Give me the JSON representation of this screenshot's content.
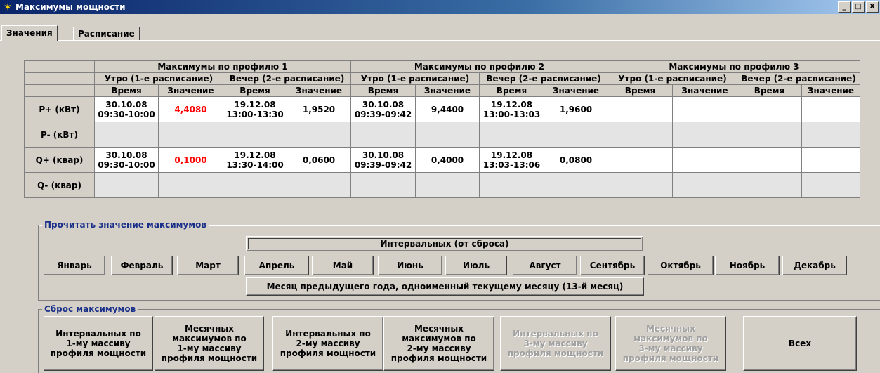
{
  "window": {
    "title": "Максимумы мощности",
    "controls": [
      "_",
      "□",
      "X"
    ]
  },
  "tabs": [
    {
      "label": "Значения",
      "active": true
    },
    {
      "label": "Расписание",
      "active": false
    }
  ],
  "table": {
    "profiles": [
      "Максимумы по профилю 1",
      "Максимумы по профилю 2",
      "Максимумы по профилю 3"
    ],
    "schedules": [
      "Утро (1-е расписание)",
      "Вечер (2-е расписание)"
    ],
    "col_time": "Время",
    "col_value": "Значение",
    "rows": [
      {
        "label": "P+ (кВт)",
        "cells": [
          {
            "t1": "30.10.08",
            "t2": "09:30-10:00"
          },
          {
            "v": "4,4080",
            "red": true
          },
          {
            "t1": "19.12.08",
            "t2": "13:00-13:30"
          },
          {
            "v": "1,9520"
          },
          {
            "t1": "30.10.08",
            "t2": "09:39-09:42"
          },
          {
            "v": "9,4400"
          },
          {
            "t1": "19.12.08",
            "t2": "13:00-13:03"
          },
          {
            "v": "1,9600"
          },
          {},
          {},
          {},
          {}
        ]
      },
      {
        "label": "P- (кВт)",
        "cells": [
          {},
          {},
          {},
          {},
          {},
          {},
          {},
          {},
          {},
          {},
          {},
          {}
        ]
      },
      {
        "label": "Q+ (квар)",
        "cells": [
          {
            "t1": "30.10.08",
            "t2": "09:30-10:00"
          },
          {
            "v": "0,1000",
            "red": true
          },
          {
            "t1": "19.12.08",
            "t2": "13:30-14:00"
          },
          {
            "v": "0,0600"
          },
          {
            "t1": "30.10.08",
            "t2": "09:39-09:42"
          },
          {
            "v": "0,4000"
          },
          {
            "t1": "19.12.08",
            "t2": "13:03-13:06"
          },
          {
            "v": "0,0800"
          },
          {},
          {},
          {},
          {}
        ]
      },
      {
        "label": "Q- (квар)",
        "cells": [
          {},
          {},
          {},
          {},
          {},
          {},
          {},
          {},
          {},
          {},
          {},
          {}
        ]
      }
    ]
  },
  "read_group": {
    "legend": "Прочитать значение максимумов",
    "interval_label": "Интервальных (от сброса)",
    "months": [
      "Январь",
      "Февраль",
      "Март",
      "Апрель",
      "Май",
      "Июнь",
      "Июль",
      "Август",
      "Сентябрь",
      "Октябрь",
      "Ноябрь",
      "Декабрь"
    ],
    "prev_year_label": "Месяц предыдущего года, одноименный текущему месяцу (13-й месяц)"
  },
  "reset_group": {
    "legend": "Сброс максимумов",
    "buttons": [
      {
        "lines": [
          "Интервальных по",
          "1-му массиву",
          "профиля мощности"
        ],
        "disabled": false
      },
      {
        "lines": [
          "Месячных",
          "максимумов по",
          "1-му массиву",
          "профиля мощности"
        ],
        "disabled": false
      },
      {
        "lines": [
          "Интервальных по",
          "2-му массиву",
          "профиля мощности"
        ],
        "disabled": false
      },
      {
        "lines": [
          "Месячных",
          "максимумов по",
          "2-му массиву",
          "профиля мощности"
        ],
        "disabled": false
      },
      {
        "lines": [
          "Интервальных по",
          "3-му массиву",
          "профиля мощности"
        ],
        "disabled": true
      },
      {
        "lines": [
          "Месячных",
          "максимумов по",
          "3-му массиву",
          "профиля мощности"
        ],
        "disabled": true
      },
      {
        "lines": [
          "Всех"
        ],
        "disabled": false
      }
    ]
  }
}
